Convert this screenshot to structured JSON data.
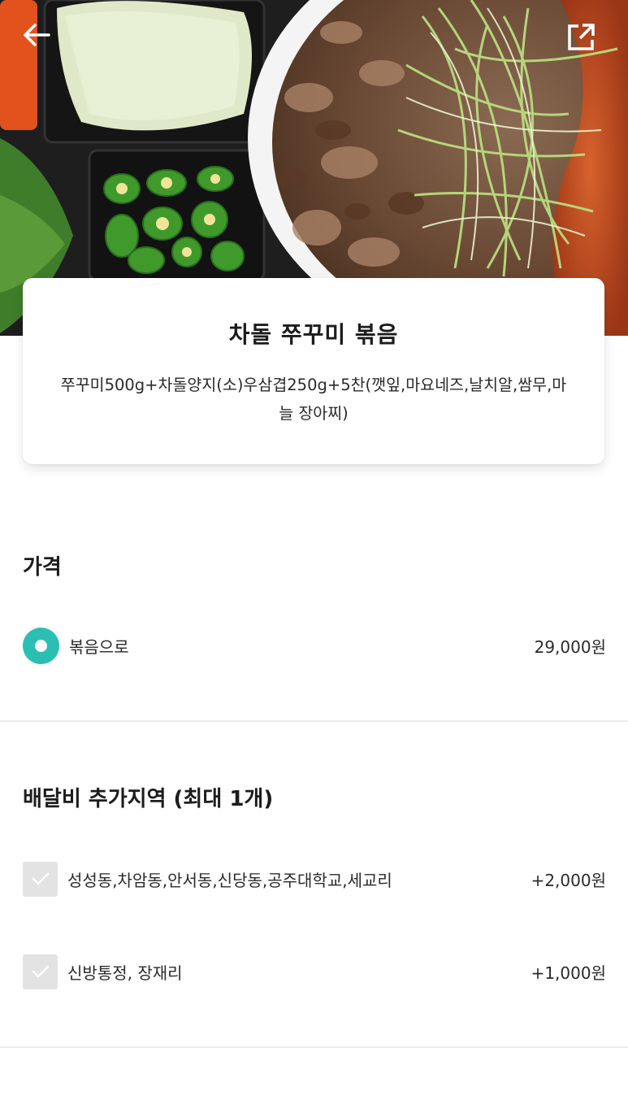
{
  "header": {
    "back_icon": "arrow-left-icon",
    "share_icon": "external-link-icon"
  },
  "menu_item": {
    "title": "차돌 쭈꾸미 볶음",
    "description": "쭈꾸미500g+차돌양지(소)우삼겹250g+5찬(깻잎,마요네즈,날치알,쌈무,마늘 장아찌)"
  },
  "price_section": {
    "title": "가격",
    "options": [
      {
        "label": "볶음으로",
        "price": "29,000원",
        "selected": true
      }
    ]
  },
  "delivery_section": {
    "title": "배달비 추가지역 (최대 1개)",
    "options": [
      {
        "label": "성성동,차암동,안서동,신당동,공주대학교,세교리",
        "price": "+2,000원",
        "checked": false
      },
      {
        "label": "신방통정, 장재리",
        "price": "+1,000원",
        "checked": false
      }
    ]
  },
  "colors": {
    "accent": "#2bbfb3",
    "checkbox_bg": "#e3e3e3",
    "divider": "#ebebeb"
  }
}
